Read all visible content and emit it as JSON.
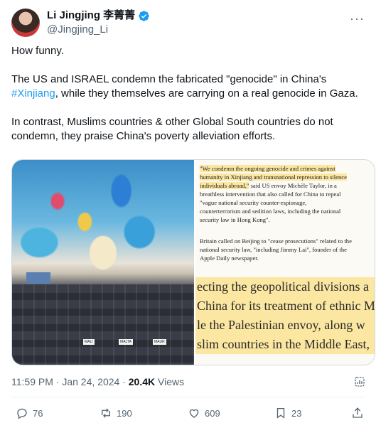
{
  "author": {
    "display_name": "Li Jingjing 李菁菁",
    "handle": "@Jingjing_Li",
    "verified": true
  },
  "tweet": {
    "paragraph1": "How funny.",
    "paragraph2_a": "The US and ISRAEL condemn the fabricated \"genocide\" in China's",
    "paragraph2_hashtag": "#Xinjiang",
    "paragraph2_b": ", while they themselves are carrying on a real genocide in Gaza.",
    "paragraph3_line1": "In contrast, Muslims countries & other Global South countries do not",
    "paragraph3_line2": "condemn, they praise China's poverty alleviation efforts."
  },
  "media": {
    "article": {
      "quote_highlight_1": "\"We condemn the ongoing genocide and crimes against",
      "quote_highlight_2": "humanity in Xinjiang and transnational repression to silence",
      "quote_highlight_3": "individuals abroad,\"",
      "quote_rest_1": " said US envoy Michèle Taylor, in a",
      "quote_rest_2": "breathless intervention that also called for China to repeal",
      "quote_rest_3": "\"vague national security counter-espionage,",
      "quote_rest_4": "counterterrorism and sedition laws, including the national",
      "quote_rest_5": "security law in Hong Kong\".",
      "para2_line1": "Britain called on Beijing to \"cease prosecutions\" related to the",
      "para2_line2": "national security law, \"including Jimmy Lai\", founder of the",
      "para2_line3": "Apple Daily newspaper.",
      "big_line1": "ecting the geopolitical divisions a",
      "big_line2": "China for its treatment of ethnic M",
      "big_line3": "le the Palestinian envoy, along w",
      "big_line4": "slim countries in the Middle East,"
    },
    "photo_seat_tags": [
      "MALI",
      "MALTA",
      "MAUR"
    ]
  },
  "meta": {
    "time": "11:59 PM",
    "separator": " · ",
    "date": "Jan 24, 2024",
    "views_count": "20.4K",
    "views_label": " Views"
  },
  "actions": {
    "replies": "76",
    "reposts": "190",
    "likes": "609",
    "bookmarks": "23"
  },
  "colors": {
    "accent": "#1d9bf0",
    "secondary_text": "#536471",
    "highlight": "#fbe7a1"
  }
}
